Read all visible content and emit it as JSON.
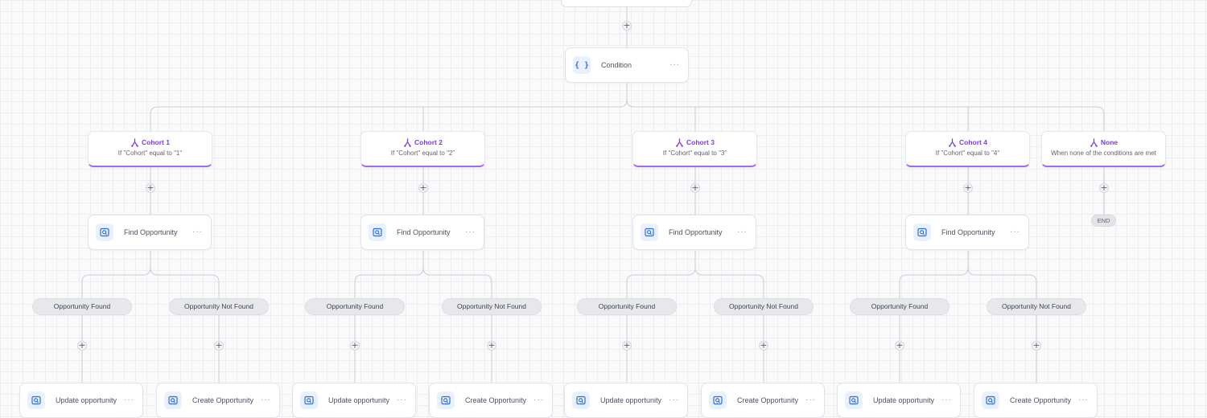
{
  "canvas_title": "",
  "condition": {
    "label": "Condition",
    "icon": "braces-icon"
  },
  "menu_glyph": "···",
  "plus_glyph": "+",
  "cohorts": [
    {
      "title": "Cohort 1",
      "subtitle": "If \"Cohort\" equal to \"1\""
    },
    {
      "title": "Cohort 2",
      "subtitle": "If \"Cohort\" equal to \"2\""
    },
    {
      "title": "Cohort 3",
      "subtitle": "If \"Cohort\" equal to \"3\""
    },
    {
      "title": "Cohort 4",
      "subtitle": "If \"Cohort\" equal to \"4\""
    },
    {
      "title": "None",
      "subtitle": "When none of the conditions are met"
    }
  ],
  "find_node": {
    "label": "Find Opportunity",
    "icon": "search-record-icon"
  },
  "branches": {
    "found": "Opportunity Found",
    "not_found": "Opportunity Not Found"
  },
  "update_node": {
    "label": "Update opportunity",
    "icon": "record-icon"
  },
  "create_node": {
    "label": "Create Opportunity",
    "icon": "record-icon"
  },
  "end_label": "END",
  "colors": {
    "accent_purple": "#7c3aed",
    "icon_blue": "#2f6fe4",
    "icon_bg": "#e9f0fe",
    "line": "#c9ccd2"
  }
}
